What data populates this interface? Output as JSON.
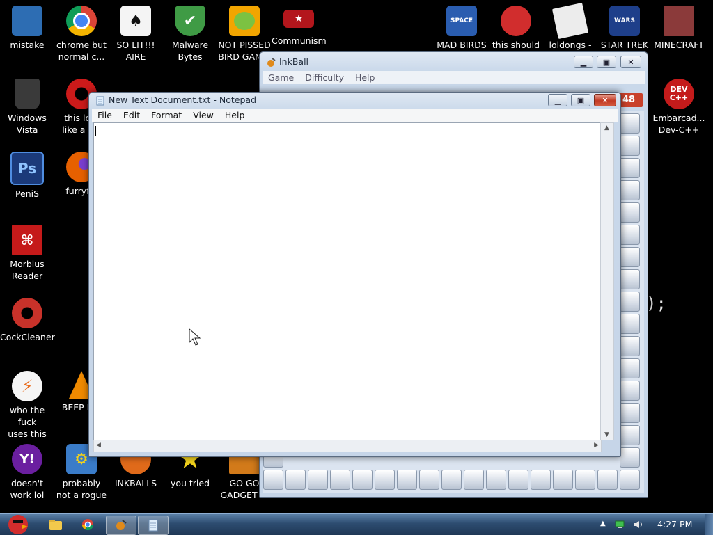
{
  "desktop": {
    "icons": [
      {
        "id": "mistake",
        "label": "mistake",
        "color": "#2d6db3",
        "icon": "computer-icon"
      },
      {
        "id": "chrome",
        "label": "chrome but\nnormal c...",
        "color": "#2f9e44",
        "icon": "chrome-icon"
      },
      {
        "id": "solit",
        "label": "SO LIT!!!\nAIRE",
        "color": "#eaeaea",
        "icon": "solitaire-icon"
      },
      {
        "id": "malware",
        "label": "Malware\nBytes",
        "color": "#3f9b45",
        "icon": "shield-icon"
      },
      {
        "id": "pissed",
        "label": "NOT PISSED\nBIRD GAM...",
        "color": "#f2a500",
        "icon": "bad-piggies-icon"
      },
      {
        "id": "communism",
        "label": "Communism",
        "color": "#b3161c",
        "icon": "communism-icon"
      },
      {
        "id": "madbirds",
        "label": "MAD BIRDS",
        "color": "#2a5db0",
        "icon": "angry-birds-space-icon"
      },
      {
        "id": "thisshould",
        "label": "this should",
        "color": "#d12d2d",
        "icon": "angry-bird-icon"
      },
      {
        "id": "loldongs",
        "label": "loldongs -",
        "color": "#e7e7e7",
        "icon": "document-icon"
      },
      {
        "id": "startrek",
        "label": "STAR TREK",
        "color": "#1e3f8a",
        "icon": "star-wars-icon"
      },
      {
        "id": "minecraft",
        "label": "MINECRAFT",
        "color": "#8b3a3a",
        "icon": "minecraft-icon"
      },
      {
        "id": "vista",
        "label": "Windows\nVista",
        "color": "#3a3a3a",
        "icon": "recycle-bin-icon"
      },
      {
        "id": "opera",
        "label": "this lo...\nlike a v...",
        "color": "#cc1a1a",
        "icon": "opera-icon"
      },
      {
        "id": "devcpp",
        "label": "Embarcad...\nDev-C++",
        "color": "#c41b1b",
        "icon": "dev-cpp-icon",
        "text": "DEV\nC++"
      },
      {
        "id": "ps",
        "label": "PeniS",
        "color": "#1b3a7a",
        "icon": "photoshop-icon",
        "text": "Ps"
      },
      {
        "id": "firefox",
        "label": "furryf...",
        "color": "#e66000",
        "icon": "firefox-icon"
      },
      {
        "id": "morbius",
        "label": "Morbius\nReader",
        "color": "#c51a1a",
        "icon": "pdf-reader-icon"
      },
      {
        "id": "ccleaner",
        "label": "CockCleaner",
        "color": "#c8322a",
        "icon": "ccleaner-icon"
      },
      {
        "id": "whothe",
        "label": "who the fuck\nuses this",
        "color": "#e96a1b",
        "icon": "avast-icon"
      },
      {
        "id": "beep",
        "label": "BEEP B...",
        "color": "#f08a00",
        "icon": "vlc-icon"
      },
      {
        "id": "yahoo",
        "label": "doesn't\nwork lol",
        "color": "#6b1fa0",
        "icon": "yahoo-messenger-icon"
      },
      {
        "id": "rogue",
        "label": "probably\nnot a rogue",
        "color": "#3a7cc9",
        "icon": "settings-gears-icon"
      },
      {
        "id": "inkballs",
        "label": "INKBALLS",
        "color": "#e06a1a",
        "icon": "inkball-icon"
      },
      {
        "id": "youtried",
        "label": "you tried",
        "color": "#f2d21c",
        "icon": "star-icon"
      },
      {
        "id": "gogo",
        "label": "GO GO\nGADGET ...",
        "color": "#d27a1a",
        "icon": "gadget-icon"
      }
    ],
    "code_fragment": ");"
  },
  "inkball": {
    "title": "InkBall",
    "menu": [
      "Game",
      "Difficulty",
      "Help"
    ],
    "score": "48"
  },
  "notepad": {
    "title": "New Text Document.txt - Notepad",
    "menu": [
      "File",
      "Edit",
      "Format",
      "View",
      "Help"
    ],
    "content": ""
  },
  "taskbar": {
    "clock": "4:27 PM"
  }
}
